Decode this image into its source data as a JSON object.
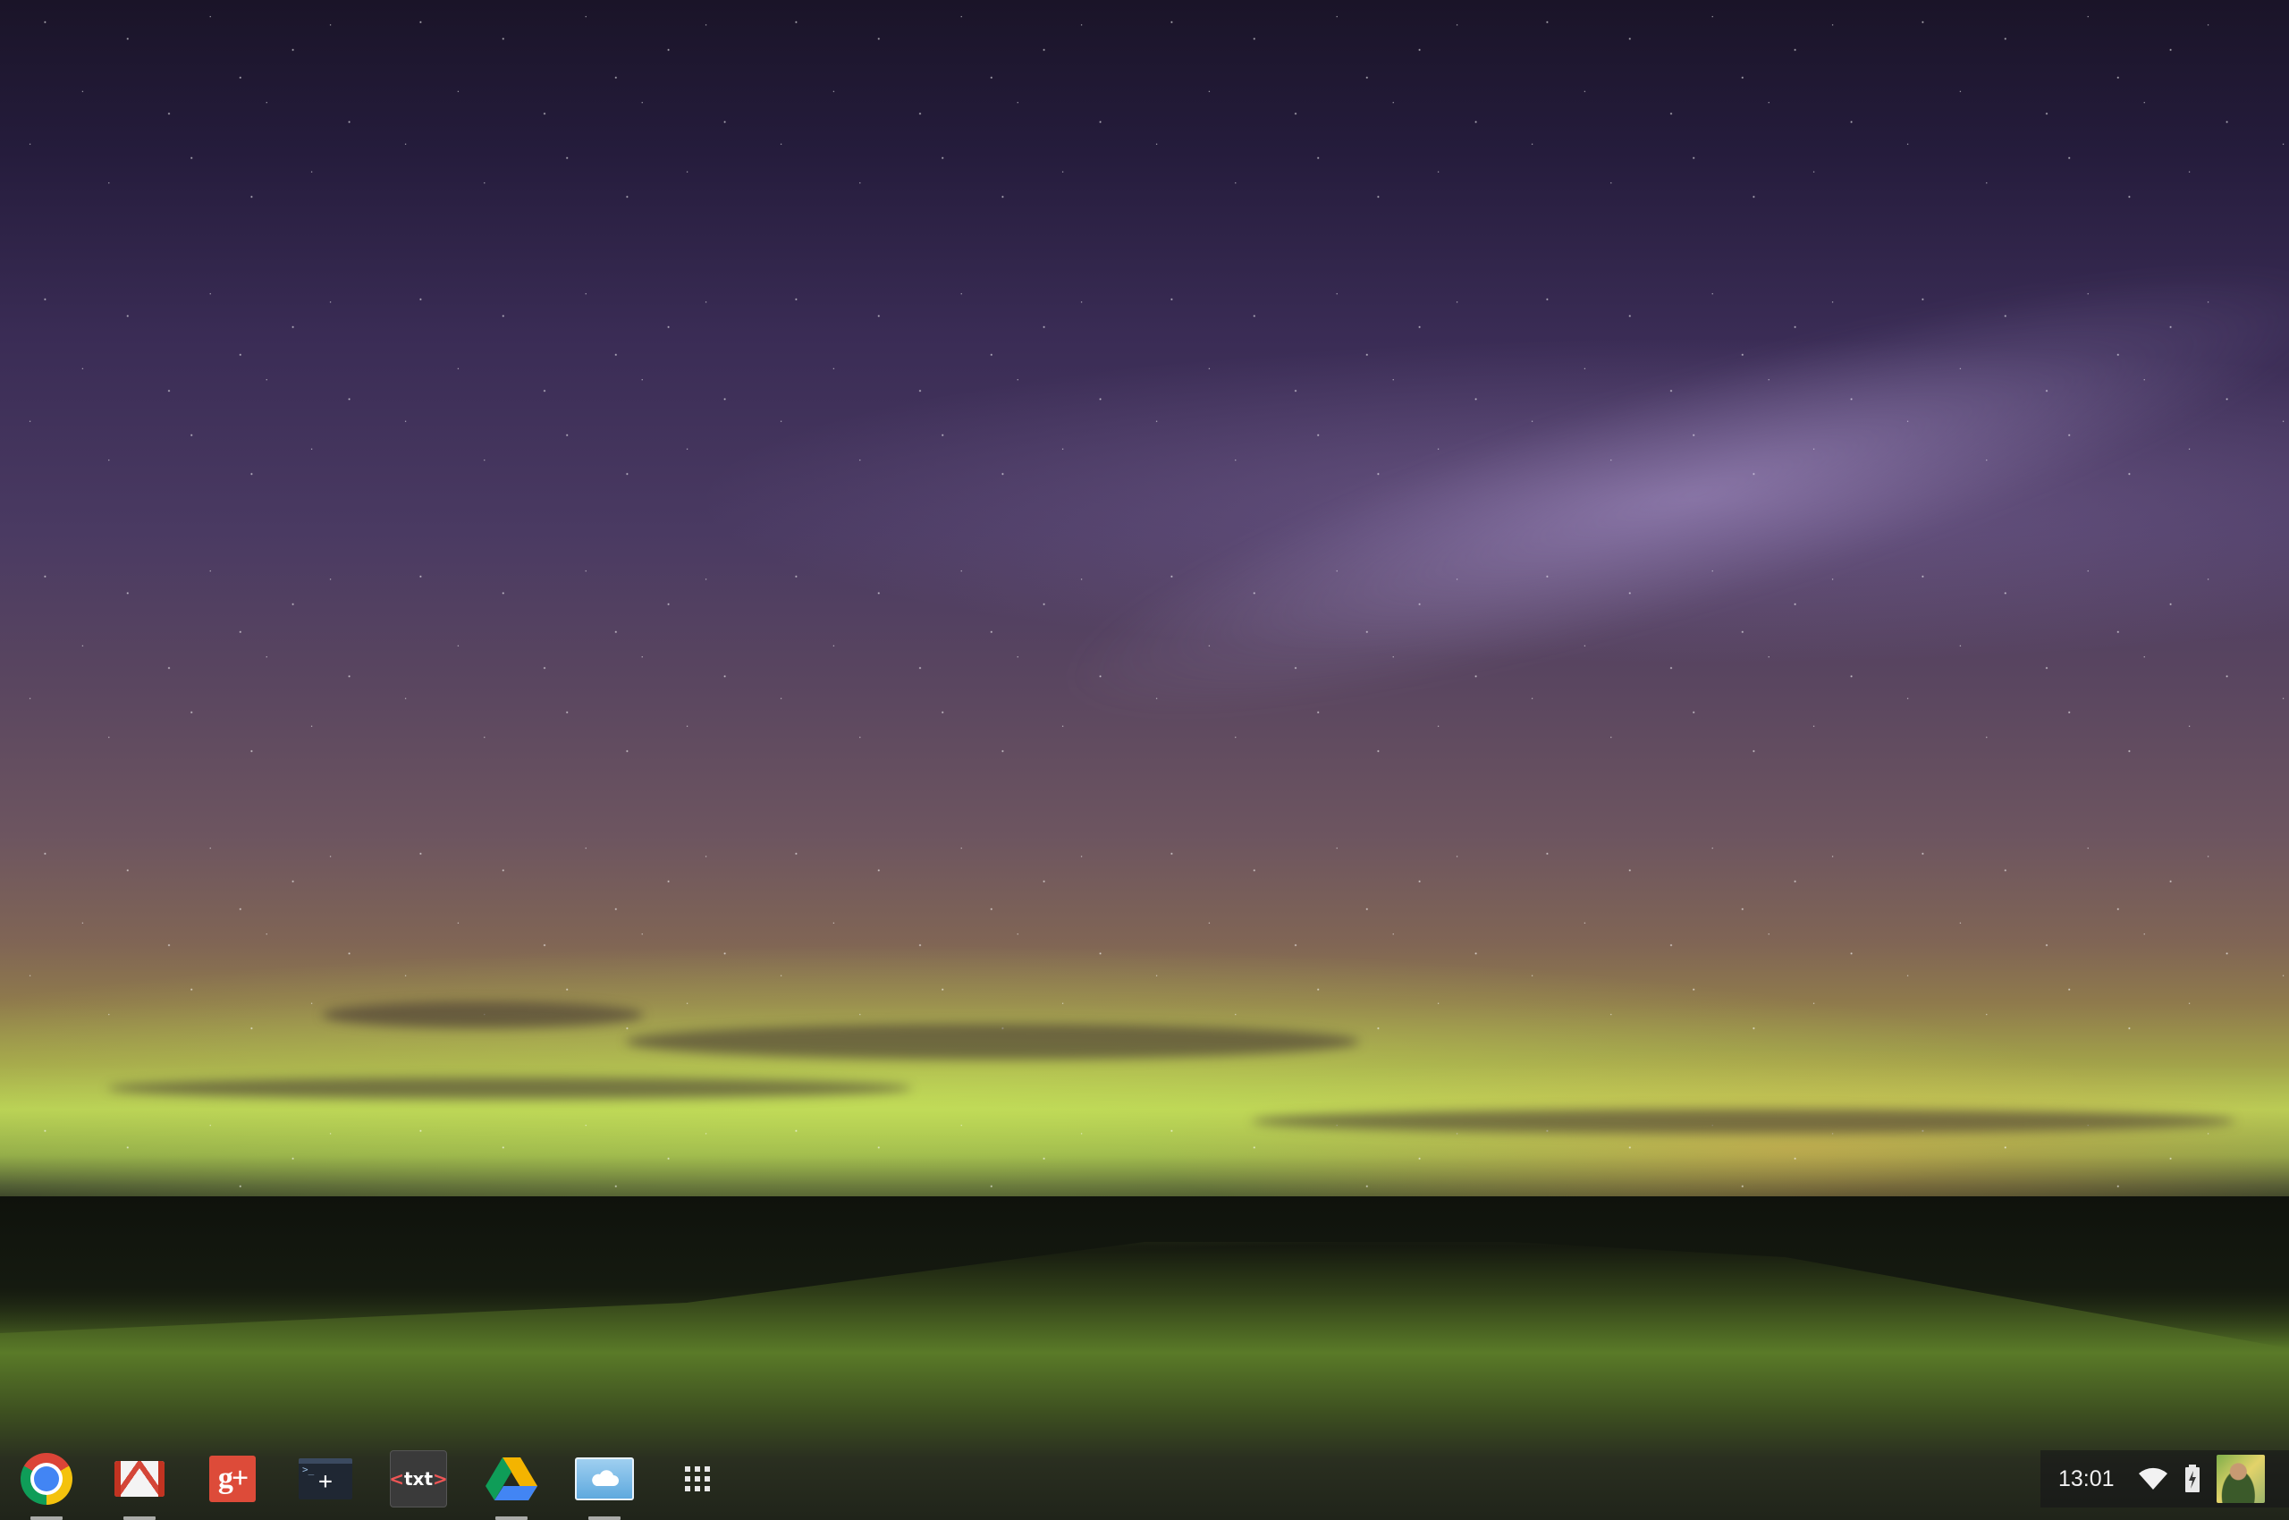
{
  "wallpaper": {
    "description_colors": {
      "sky_top": "#1a1428",
      "aurora": "#b8cf55",
      "water": "#5a7a28"
    }
  },
  "shelf": {
    "apps": [
      {
        "id": "chrome",
        "icon": "chrome-icon",
        "active": true
      },
      {
        "id": "gmail",
        "icon": "gmail-icon",
        "active": true
      },
      {
        "id": "google-plus",
        "icon": "google-plus-icon",
        "label": "g+",
        "active": false
      },
      {
        "id": "terminal",
        "icon": "terminal-icon",
        "label": "+",
        "prompt": ">_",
        "active": false
      },
      {
        "id": "text",
        "icon": "text-editor-icon",
        "label_left": "<",
        "label": "txt",
        "label_right": ">",
        "active": false
      },
      {
        "id": "drive",
        "icon": "google-drive-icon",
        "active": true
      },
      {
        "id": "cloud",
        "icon": "cloud-icon",
        "active": true
      }
    ],
    "app_launcher_icon": "apps-grid-icon"
  },
  "status": {
    "time": "13:01",
    "wifi_icon": "wifi-icon",
    "battery_icon": "battery-charging-icon",
    "avatar_icon": "user-avatar"
  }
}
